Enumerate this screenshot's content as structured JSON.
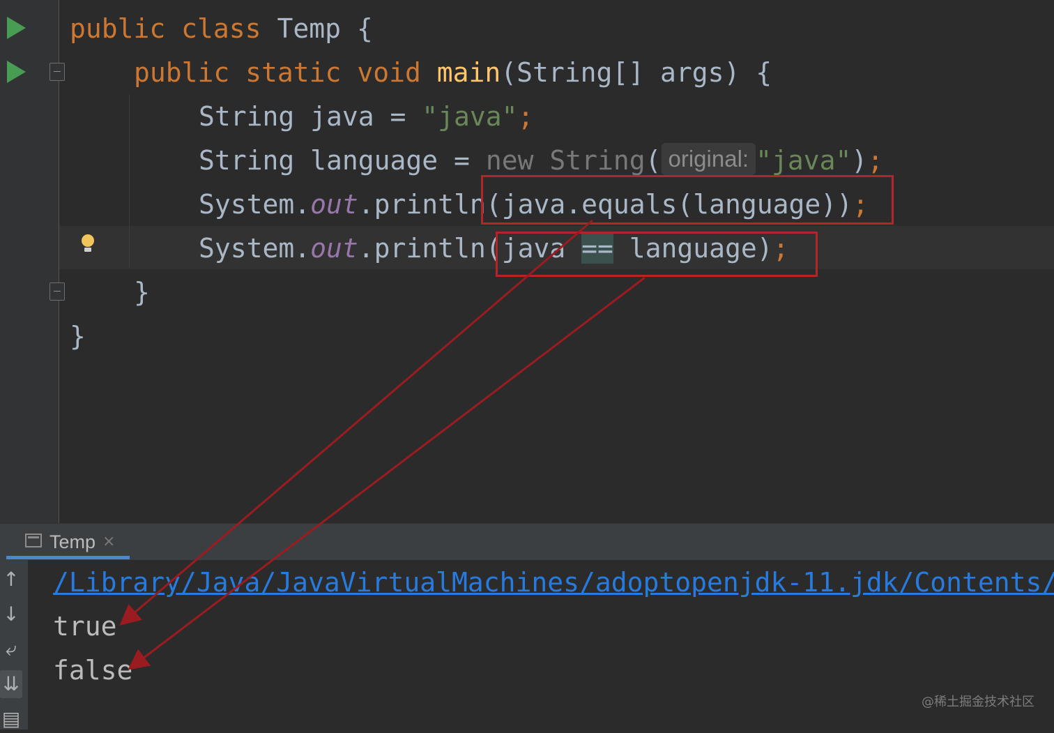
{
  "editor": {
    "lines": [
      {
        "tokens": [
          {
            "text": "public ",
            "cls": "kw"
          },
          {
            "text": "class ",
            "cls": "kw"
          },
          {
            "text": "Temp {",
            "cls": ""
          }
        ]
      },
      {
        "tokens": [
          {
            "text": "public ",
            "cls": "kw"
          },
          {
            "text": "static ",
            "cls": "kw"
          },
          {
            "text": "void ",
            "cls": "kw"
          },
          {
            "text": "main",
            "cls": "fn"
          },
          {
            "text": "(String[] args) {",
            "cls": ""
          }
        ]
      },
      {
        "tokens": [
          {
            "text": "String java = ",
            "cls": ""
          },
          {
            "text": "\"java\"",
            "cls": "str"
          },
          {
            "text": ";",
            "cls": "semi"
          }
        ]
      },
      {
        "tokens": [
          {
            "text": "String language = ",
            "cls": ""
          },
          {
            "text": "new ",
            "cls": "dim"
          },
          {
            "text": "String",
            "cls": "dim"
          },
          {
            "text": "(",
            "cls": ""
          },
          {
            "text": "original:",
            "cls": "hint"
          },
          {
            "text": "\"java\"",
            "cls": "str"
          },
          {
            "text": ")",
            "cls": ""
          },
          {
            "text": ";",
            "cls": "semi"
          }
        ]
      },
      {
        "tokens": [
          {
            "text": "System.",
            "cls": ""
          },
          {
            "text": "out",
            "cls": "field"
          },
          {
            "text": ".println(java.equals(language))",
            "cls": ""
          },
          {
            "text": ";",
            "cls": "semi"
          }
        ]
      },
      {
        "tokens": [
          {
            "text": "System.",
            "cls": ""
          },
          {
            "text": "out",
            "cls": "field"
          },
          {
            "text": ".println(java ",
            "cls": ""
          },
          {
            "text": "==",
            "cls": "op-hl"
          },
          {
            "text": " language)",
            "cls": ""
          },
          {
            "text": ";",
            "cls": "semi"
          }
        ]
      },
      {
        "tokens": [
          {
            "text": "}",
            "cls": ""
          }
        ]
      },
      {
        "tokens": [
          {
            "text": "}",
            "cls": ""
          }
        ]
      }
    ]
  },
  "gutter": {
    "run_icons": [
      "run-class-icon",
      "run-main-icon"
    ],
    "intention_icon": "lightbulb-icon"
  },
  "run_panel": {
    "tab_label": "Temp",
    "tab_close": "×",
    "toolbar_icons": {
      "up": "↑",
      "down": "↓",
      "wrap": "⤶",
      "scroll_end": "⇊",
      "print": "▤"
    },
    "console": {
      "command_line": "/Library/Java/JavaVirtualMachines/adoptopenjdk-11.jdk/Contents/",
      "output": [
        "true",
        "false"
      ]
    }
  },
  "annotations": {
    "highlight_color": "#b4252a"
  },
  "watermark": "@稀土掘金技术社区"
}
